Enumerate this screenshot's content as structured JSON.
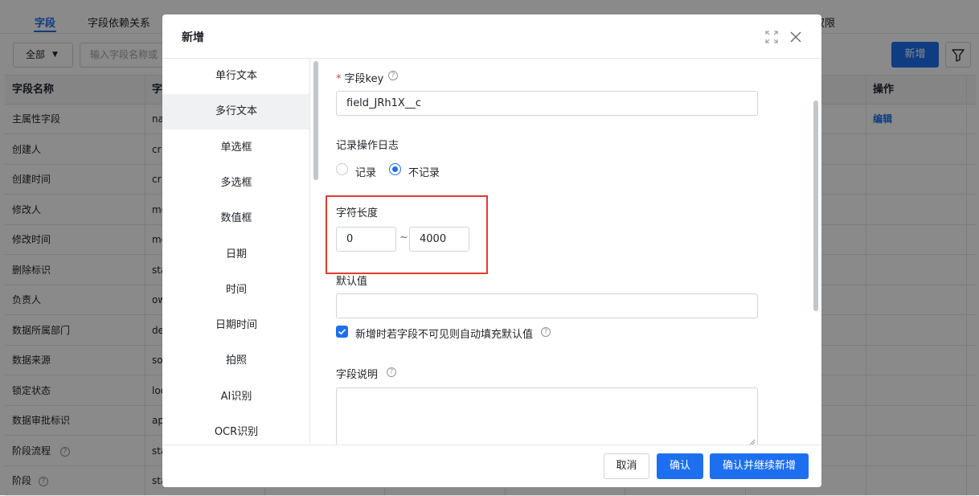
{
  "background": {
    "tabs": [
      "字段",
      "字段依赖关系"
    ],
    "tab_right": "权限",
    "filter_select": "全部",
    "search_placeholder": "输入字段名称或",
    "new_button": "新增",
    "headers": [
      "字段名称",
      "字",
      "操作"
    ],
    "rows": [
      {
        "name": "主属性字段",
        "key": "na",
        "action": "编辑"
      },
      {
        "name": "创建人",
        "key": "cr",
        "action": ""
      },
      {
        "name": "创建时间",
        "key": "cr",
        "action": ""
      },
      {
        "name": "修改人",
        "key": "mo",
        "action": ""
      },
      {
        "name": "修改时间",
        "key": "mo",
        "action": ""
      },
      {
        "name": "删除标识",
        "key": "sta",
        "action": ""
      },
      {
        "name": "负责人",
        "key": "ow",
        "action": ""
      },
      {
        "name": "数据所属部门",
        "key": "de",
        "action": ""
      },
      {
        "name": "数据来源",
        "key": "so",
        "action": ""
      },
      {
        "name": "锁定状态",
        "key": "loc",
        "action": ""
      },
      {
        "name": "数据审批标识",
        "key": "ap",
        "action": ""
      },
      {
        "name": "阶段流程",
        "key": "sta",
        "action": ""
      },
      {
        "name": "阶段",
        "key": "sta",
        "action": ""
      }
    ]
  },
  "modal": {
    "title": "新增",
    "sidebar_items": [
      "单行文本",
      "多行文本",
      "单选框",
      "多选框",
      "数值框",
      "日期",
      "时间",
      "日期时间",
      "拍照",
      "AI识别",
      "OCR识别"
    ],
    "active_item": "多行文本",
    "form": {
      "key_label": "字段key",
      "key_value": "field_JRh1X__c",
      "log_label": "记录操作日志",
      "log_options": [
        "记录",
        "不记录"
      ],
      "log_selected": "不记录",
      "length_label": "字符长度",
      "length_min": "0",
      "length_separator": "~",
      "length_max": "4000",
      "default_label": "默认值",
      "default_value": "",
      "autofill_label": "新增时若字段不可见则自动填充默认值",
      "autofill_checked": true,
      "desc_label": "字段说明"
    },
    "buttons": {
      "cancel": "取消",
      "confirm": "确认",
      "confirm_continue": "确认并继续新增"
    }
  },
  "colors": {
    "primary": "#1d6ff0",
    "highlight_box": "#e23b2e",
    "required_mark": "#e54545"
  }
}
